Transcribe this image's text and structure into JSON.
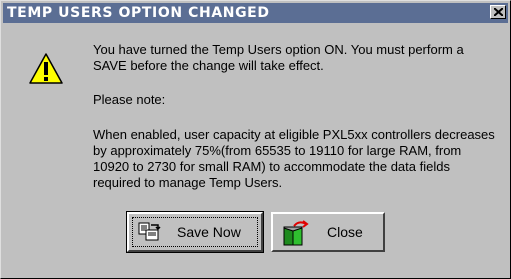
{
  "dialog": {
    "title": "TEMP USERS OPTION CHANGED",
    "close_icon": "close-icon",
    "warning_icon": "warning-icon",
    "message_line1": "You have turned the Temp Users option ON.  You must perform a SAVE before the change will take effect.",
    "message_line2": "Please note:",
    "message_line3": "When enabled, user capacity at eligible PXL5xx controllers decreases by approximately 75%(from 65535 to 19110 for large RAM, from 10920 to 2730 for small RAM) to accommodate the data fields required to manage Temp Users."
  },
  "buttons": {
    "save_label": "Save Now",
    "save_icon": "save-icon",
    "close_label": "Close",
    "close_icon": "exit-door-icon"
  },
  "colors": {
    "titlebar": "#5b6e94",
    "face": "#c0c0c0",
    "warning": "#ffff00"
  }
}
